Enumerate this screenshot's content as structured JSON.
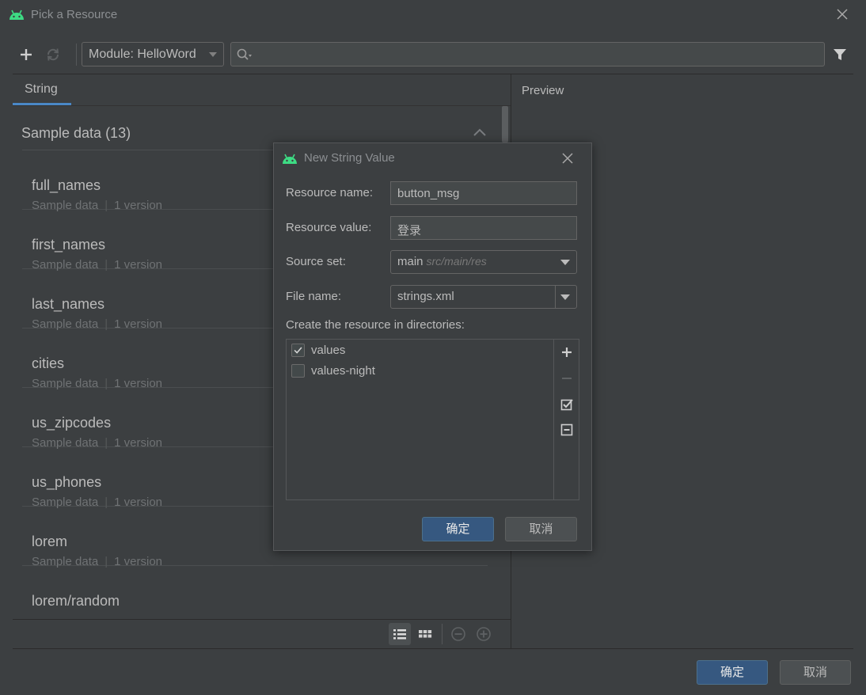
{
  "window": {
    "title": "Pick a Resource",
    "icon": "android-icon"
  },
  "toolbar": {
    "add_icon": "plus-icon",
    "refresh_icon": "refresh-icon",
    "module_label": "Module: HelloWord",
    "search_value": "",
    "filter_icon": "filter-icon"
  },
  "tabs": [
    {
      "label": "String",
      "selected": true
    }
  ],
  "section": {
    "title": "Sample data (13)",
    "expanded": true
  },
  "items": [
    {
      "name": "full_names",
      "source": "Sample data",
      "versions": "1 version"
    },
    {
      "name": "first_names",
      "source": "Sample data",
      "versions": "1 version"
    },
    {
      "name": "last_names",
      "source": "Sample data",
      "versions": "1 version"
    },
    {
      "name": "cities",
      "source": "Sample data",
      "versions": "1 version"
    },
    {
      "name": "us_zipcodes",
      "source": "Sample data",
      "versions": "1 version"
    },
    {
      "name": "us_phones",
      "source": "Sample data",
      "versions": "1 version"
    },
    {
      "name": "lorem",
      "source": "Sample data",
      "versions": "1 version"
    },
    {
      "name": "lorem/random"
    }
  ],
  "preview": {
    "label": "Preview"
  },
  "footer": {
    "ok_label": "确定",
    "cancel_label": "取消"
  },
  "dialog": {
    "title": "New String Value",
    "resource_name_label": "Resource name:",
    "resource_name_value": "button_msg",
    "resource_value_label": "Resource value:",
    "resource_value_value": "登录",
    "source_set_label": "Source set:",
    "source_set_value": "main",
    "source_set_hint": "src/main/res",
    "file_name_label": "File name:",
    "file_name_value": "strings.xml",
    "directories_label": "Create the resource in directories:",
    "directories": [
      {
        "label": "values",
        "checked": true
      },
      {
        "label": "values-night",
        "checked": false
      }
    ],
    "ok_label": "确定",
    "cancel_label": "取消"
  },
  "colors": {
    "background": "#3c3f41",
    "accent": "#4a88c7",
    "primary_button": "#365880",
    "android_green": "#3ddc84"
  }
}
